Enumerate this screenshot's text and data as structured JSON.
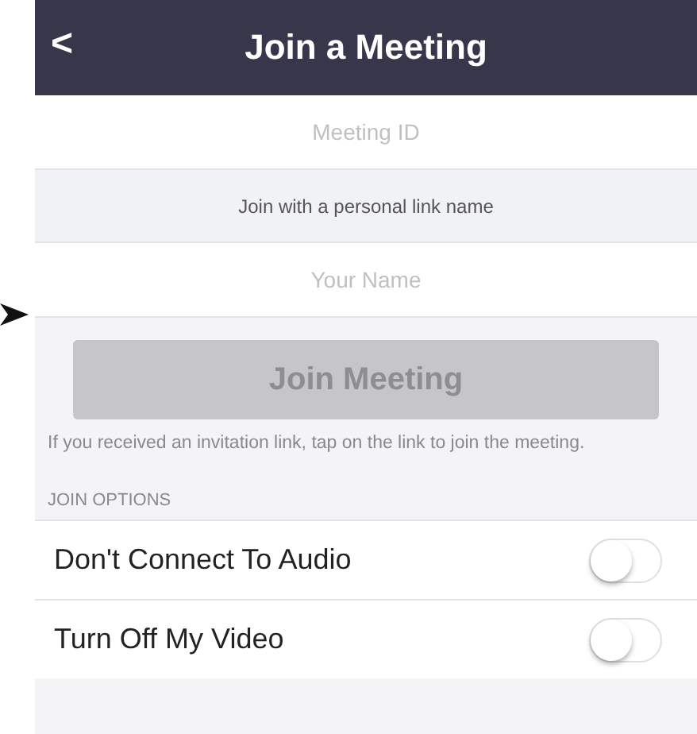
{
  "header": {
    "back": "<",
    "title": "Join a Meeting"
  },
  "meeting_id": {
    "placeholder": "Meeting ID"
  },
  "personal_link": "Join with a personal link name",
  "name_field": {
    "placeholder": "Your Name"
  },
  "join_button": {
    "label": "Join Meeting",
    "disabled": true
  },
  "hint": "If you received an invitation link, tap on the link to join the meeting.",
  "section_label": "JOIN OPTIONS",
  "options": [
    {
      "label": "Don't Connect To Audio",
      "on": false
    },
    {
      "label": "Turn Off My Video",
      "on": false
    }
  ]
}
